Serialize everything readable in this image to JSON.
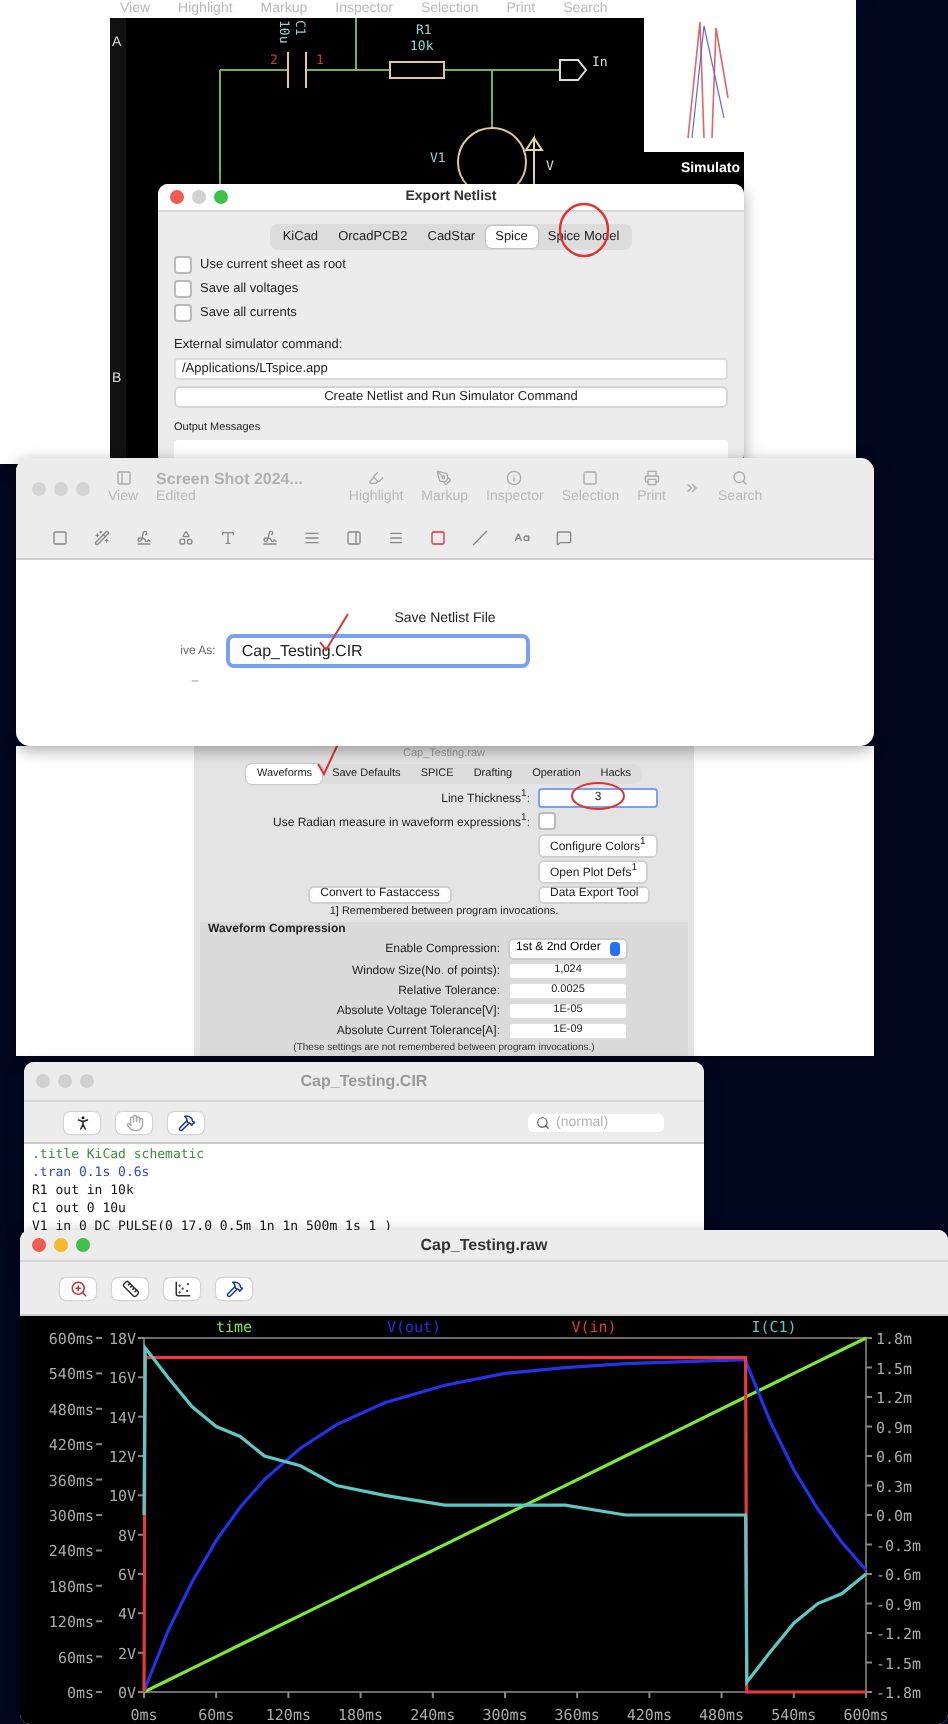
{
  "back_window": {
    "toolbar": [
      "View",
      "Highlight",
      "Markup",
      "Inspector",
      "Selection",
      "Print",
      "Search"
    ],
    "schematic": {
      "border_marks": [
        "A",
        "B"
      ],
      "labels": [
        {
          "text": "10u",
          "kind": "vertical_value"
        },
        {
          "text": "C1",
          "kind": "vertical_ref"
        },
        {
          "text": "R1",
          "kind": "ref"
        },
        {
          "text": "10k",
          "kind": "value"
        },
        {
          "text": "2",
          "kind": "pin"
        },
        {
          "text": "1",
          "kind": "pin"
        },
        {
          "text": "In",
          "kind": "port"
        },
        {
          "text": "V1",
          "kind": "ref"
        },
        {
          "text": "V",
          "kind": "arrow"
        }
      ],
      "side_title": "Simulato"
    }
  },
  "export_netlist": {
    "title": "Export Netlist",
    "tabs": [
      {
        "label": "KiCad",
        "selected": false
      },
      {
        "label": "OrcadPCB2",
        "selected": false
      },
      {
        "label": "CadStar",
        "selected": false
      },
      {
        "label": "Spice",
        "selected": true
      },
      {
        "label": "Spice Model",
        "selected": false
      }
    ],
    "checkboxes": [
      {
        "label": "Use current sheet as root",
        "checked": false
      },
      {
        "label": "Save all voltages",
        "checked": false
      },
      {
        "label": "Save all currents",
        "checked": false
      }
    ],
    "command_label": "External simulator command:",
    "command_value": "/Applications/LTspice.app",
    "run_button": "Create Netlist and Run Simulator Command",
    "output_label": "Output Messages"
  },
  "preview_window": {
    "title": "Screen Shot 2024...",
    "subtitle": "Edited",
    "toolbar": [
      "View",
      "Highlight",
      "Markup",
      "Inspector",
      "Selection",
      "Print",
      "Search"
    ],
    "heading": "Save Netlist File",
    "save_as_label": "ive As:",
    "filename": "Cap_Testing.CIR",
    "dash": "–"
  },
  "control_panel": {
    "title": "Cap_Testing.raw",
    "tabs": [
      {
        "label": "Waveforms",
        "selected": true
      },
      {
        "label": "Save Defaults",
        "selected": false
      },
      {
        "label": "SPICE",
        "selected": false
      },
      {
        "label": "Drafting",
        "selected": false
      },
      {
        "label": "Operation",
        "selected": false
      },
      {
        "label": "Hacks",
        "selected": false
      }
    ],
    "line_thickness_label": "Line Thickness$^{1}$:",
    "line_thickness": "3",
    "radian_label": "Use Radian measure in waveform expressions$^{1}$:",
    "radian_checked": false,
    "buttons": [
      "Configure Colors$^{1}$",
      "Open Plot Defs$^{1}$",
      "Data Export Tool"
    ],
    "convert_button": "Convert to Fastaccess",
    "note": "1] Remembered between program invocations.",
    "compression": {
      "title": "Waveform Compression",
      "select_label": "Enable Compression:",
      "select_value": "1st & 2nd Order",
      "fields": [
        {
          "label": "Window Size(No. of points):",
          "value": "1,024"
        },
        {
          "label": "Relative Tolerance:",
          "value": "0.0025"
        },
        {
          "label": "Absolute Voltage Tolerance[V]:",
          "value": "1E-05"
        },
        {
          "label": "Absolute Current Tolerance[A]:",
          "value": "1E-09"
        }
      ],
      "note": "(These settings are not remembered between program invocations.)"
    }
  },
  "netlist_window": {
    "title": "Cap_Testing.CIR",
    "search_placeholder": "(normal)",
    "lines": [
      {
        "text": ".title KiCad schematic",
        "kind": "comment"
      },
      {
        "text": ".tran 0.1s 0.6s",
        "kind": "directive"
      },
      {
        "text": "R1 out in 10k",
        "kind": "plain"
      },
      {
        "text": "C1 out 0 10u",
        "kind": "plain"
      },
      {
        "text": "V1 in 0 DC PULSE(0 17.0 0.5m 1n 1n 500m 1s 1 )",
        "kind": "plain"
      }
    ]
  },
  "waveform_window": {
    "title": "Cap_Testing.raw",
    "chart_data": {
      "type": "line",
      "x": [
        0,
        1,
        20,
        40,
        60,
        80,
        100,
        130,
        160,
        200,
        250,
        300,
        350,
        400,
        450,
        500,
        501,
        520,
        540,
        560,
        580,
        600
      ],
      "xlim": [
        0,
        600
      ],
      "ylim": [
        0,
        18
      ],
      "y2lim": [
        -1.8,
        1.8
      ],
      "y3lim": [
        0,
        600
      ],
      "xticks": [
        {
          "value": 0,
          "label": "0ms"
        },
        {
          "value": 60,
          "label": "60ms"
        },
        {
          "value": 120,
          "label": "120ms"
        },
        {
          "value": 180,
          "label": "180ms"
        },
        {
          "value": 240,
          "label": "240ms"
        },
        {
          "value": 300,
          "label": "300ms"
        },
        {
          "value": 360,
          "label": "360ms"
        },
        {
          "value": 420,
          "label": "420ms"
        },
        {
          "value": 480,
          "label": "480ms"
        },
        {
          "value": 540,
          "label": "540ms"
        },
        {
          "value": 600,
          "label": "600ms"
        }
      ],
      "yticks": [
        {
          "value": 0,
          "label": "0V"
        },
        {
          "value": 2,
          "label": "2V"
        },
        {
          "value": 4,
          "label": "4V"
        },
        {
          "value": 6,
          "label": "6V"
        },
        {
          "value": 8,
          "label": "8V"
        },
        {
          "value": 10,
          "label": "10V"
        },
        {
          "value": 12,
          "label": "12V"
        },
        {
          "value": 14,
          "label": "14V"
        },
        {
          "value": 16,
          "label": "16V"
        },
        {
          "value": 18,
          "label": "18V"
        }
      ],
      "y2ticks": [
        {
          "value": -1.8,
          "label": "-1.8m"
        },
        {
          "value": -1.5,
          "label": "-1.5m"
        },
        {
          "value": -1.2,
          "label": "-1.2m"
        },
        {
          "value": -0.9,
          "label": "-0.9m"
        },
        {
          "value": -0.6,
          "label": "-0.6m"
        },
        {
          "value": -0.3,
          "label": "-0.3m"
        },
        {
          "value": 0,
          "label": "0.0m"
        },
        {
          "value": 0.3,
          "label": "0.3m"
        },
        {
          "value": 0.6,
          "label": "0.6m"
        },
        {
          "value": 0.9,
          "label": "0.9m"
        },
        {
          "value": 1.2,
          "label": "1.2m"
        },
        {
          "value": 1.5,
          "label": "1.5m"
        },
        {
          "value": 1.8,
          "label": "1.8m"
        }
      ],
      "y3ticks": [
        {
          "value": 0,
          "label": "0ms"
        },
        {
          "value": 60,
          "label": "60ms"
        },
        {
          "value": 120,
          "label": "120ms"
        },
        {
          "value": 180,
          "label": "180ms"
        },
        {
          "value": 240,
          "label": "240ms"
        },
        {
          "value": 300,
          "label": "300ms"
        },
        {
          "value": 360,
          "label": "360ms"
        },
        {
          "value": 420,
          "label": "420ms"
        },
        {
          "value": 480,
          "label": "480ms"
        },
        {
          "value": 540,
          "label": "540ms"
        },
        {
          "value": 600,
          "label": "600ms"
        }
      ],
      "series": [
        {
          "name": "time",
          "color": "#7ee83a",
          "axis": "y3",
          "values": [
            0,
            1,
            20,
            40,
            60,
            80,
            100,
            130,
            160,
            200,
            250,
            300,
            350,
            400,
            450,
            500,
            501,
            520,
            540,
            560,
            580,
            600
          ]
        },
        {
          "name": "V(out)",
          "color": "#2233e8",
          "values": [
            0,
            0.2,
            3.1,
            5.6,
            7.7,
            9.4,
            10.8,
            12.4,
            13.6,
            14.7,
            15.6,
            16.2,
            16.5,
            16.7,
            16.8,
            16.9,
            16.7,
            13.8,
            11.3,
            9.3,
            7.6,
            6.2
          ]
        },
        {
          "name": "V(in)",
          "color": "#e83a3a",
          "values": [
            0,
            17,
            17,
            17,
            17,
            17,
            17,
            17,
            17,
            17,
            17,
            17,
            17,
            17,
            17,
            17,
            0,
            0,
            0,
            0,
            0,
            0
          ]
        },
        {
          "name": "I(C1)",
          "color": "#5ec8c4",
          "axis": "y2",
          "values": [
            0,
            1.7,
            1.4,
            1.1,
            0.9,
            0.8,
            0.6,
            0.5,
            0.3,
            0.2,
            0.1,
            0.1,
            0.1,
            0,
            0,
            0,
            -1.7,
            -1.4,
            -1.1,
            -0.9,
            -0.8,
            -0.6
          ]
        }
      ]
    }
  }
}
